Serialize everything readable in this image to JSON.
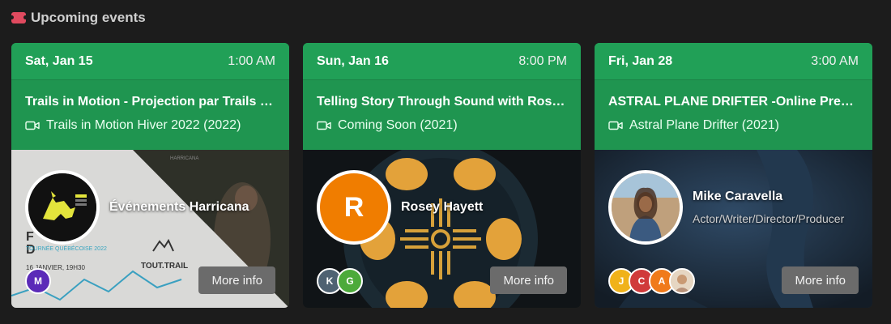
{
  "section": {
    "title": "Upcoming events",
    "icon": "ticket-icon"
  },
  "events": [
    {
      "date": "Sat, Jan 15",
      "time": "1:00 AM",
      "title": "Trails in Motion - Projection par Trails in Motion",
      "film": "Trails in Motion Hiver 2022 (2022)",
      "host": {
        "name": "Événements Harricana",
        "subtitle": "",
        "initial": ""
      },
      "attendees": [
        {
          "initial": "M",
          "color": "#5b2ab8"
        }
      ],
      "more_label": "More info",
      "poster": {
        "line1": "F",
        "line2": "D",
        "tour": "TOURNÉE QUÉBÉCOISE 2022",
        "date": "16 JANVIER, 19H30",
        "brand": "TOUT.TRAIL",
        "logo": "HARRICANA"
      }
    },
    {
      "date": "Sun, Jan 16",
      "time": "8:00 PM",
      "title": "Telling Story Through Sound with Rosey Hayett",
      "film": "Coming Soon (2021)",
      "host": {
        "name": "Rosey Hayett",
        "subtitle": "",
        "initial": "R"
      },
      "attendees": [
        {
          "initial": "K",
          "color": "#4f6272"
        },
        {
          "initial": "G",
          "color": "#4caa3a"
        }
      ],
      "more_label": "More info"
    },
    {
      "date": "Fri, Jan 28",
      "time": "3:00 AM",
      "title": "ASTRAL PLANE DRIFTER -Online Premiere",
      "film": "Astral Plane Drifter (2021)",
      "host": {
        "name": "Mike Caravella",
        "subtitle": "Actor/Writer/Director/Producer",
        "initial": ""
      },
      "attendees": [
        {
          "initial": "J",
          "color": "#f0b21a"
        },
        {
          "initial": "C",
          "color": "#d03a3a"
        },
        {
          "initial": "A",
          "color": "#f07a1a"
        },
        {
          "initial": "",
          "color": "#d9c2a8"
        }
      ],
      "more_label": "More info"
    }
  ],
  "colors": {
    "header_green": "#1f9550",
    "date_green": "#21a057",
    "button_gray": "#6b6b6b",
    "rosey_orange": "#f07d00"
  }
}
